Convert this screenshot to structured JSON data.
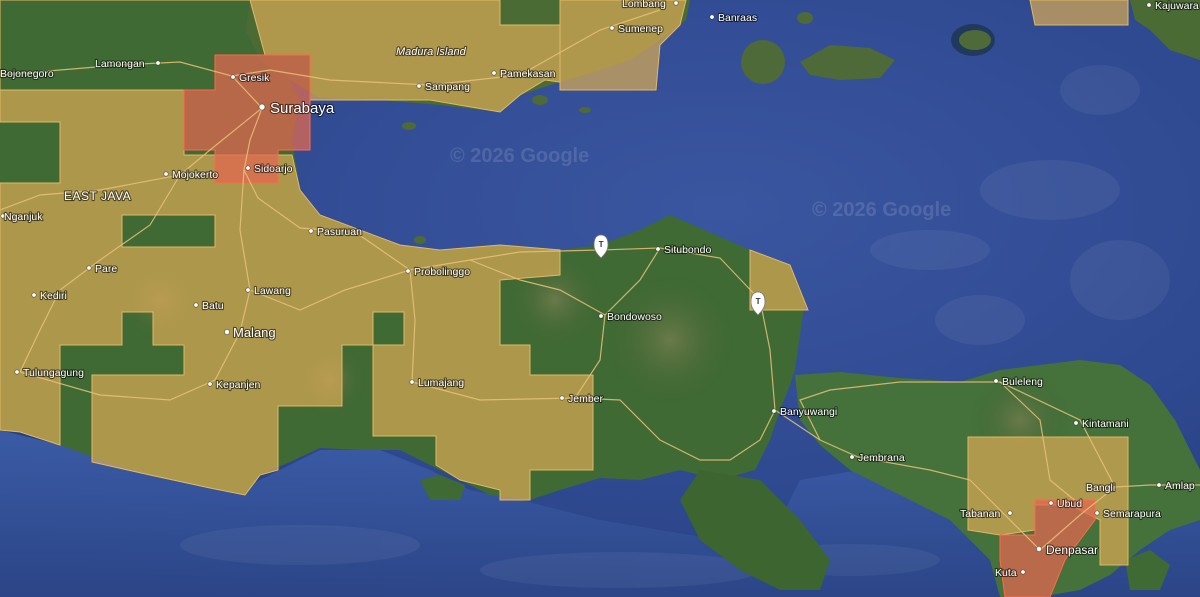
{
  "map": {
    "watermark": "© 2026 Google",
    "palette": {
      "sea": "#30488e",
      "land": "#3f6a33",
      "tan_overlay": "#d7a955",
      "red_overlay": "#e06850",
      "road": "#e9c17a"
    },
    "places": {
      "lombang": "Lombang",
      "sumenep": "Sumenep",
      "banraas": "Banraas",
      "kajuwara": "Kajuwara",
      "madura_island": "Madura Island",
      "pamekasan": "Pamekasan",
      "sampang": "Sampang",
      "bojonegoro": "Bojonegoro",
      "lamongan": "Lamongan",
      "gresik": "Gresik",
      "surabaya": "Surabaya",
      "sidoarjo": "Sidoarjo",
      "mojokerto": "Mojokerto",
      "east_java": "EAST JAVA",
      "nganjuk": "Nganjuk",
      "pasuruan": "Pasuruan",
      "probolinggo": "Probolinggo",
      "situbondo": "Situbondo",
      "pare": "Pare",
      "kediri": "Kediri",
      "lawang": "Lawang",
      "batu": "Batu",
      "malang": "Malang",
      "bondowoso": "Bondowoso",
      "tulungagung": "Tulungagung",
      "kepanjen": "Kepanjen",
      "lumajang": "Lumajang",
      "jember": "Jember",
      "banyuwangi": "Banyuwangi",
      "buleleng": "Buleleng",
      "kintamani": "Kintamani",
      "jembrana": "Jembrana",
      "bangli": "Bangli",
      "amlap": "Amlap",
      "tabanan": "Tabanan",
      "ubud": "Ubud",
      "semarapura": "Semarapura",
      "denpasar": "Denpasar",
      "kuta": "Kuta"
    }
  }
}
